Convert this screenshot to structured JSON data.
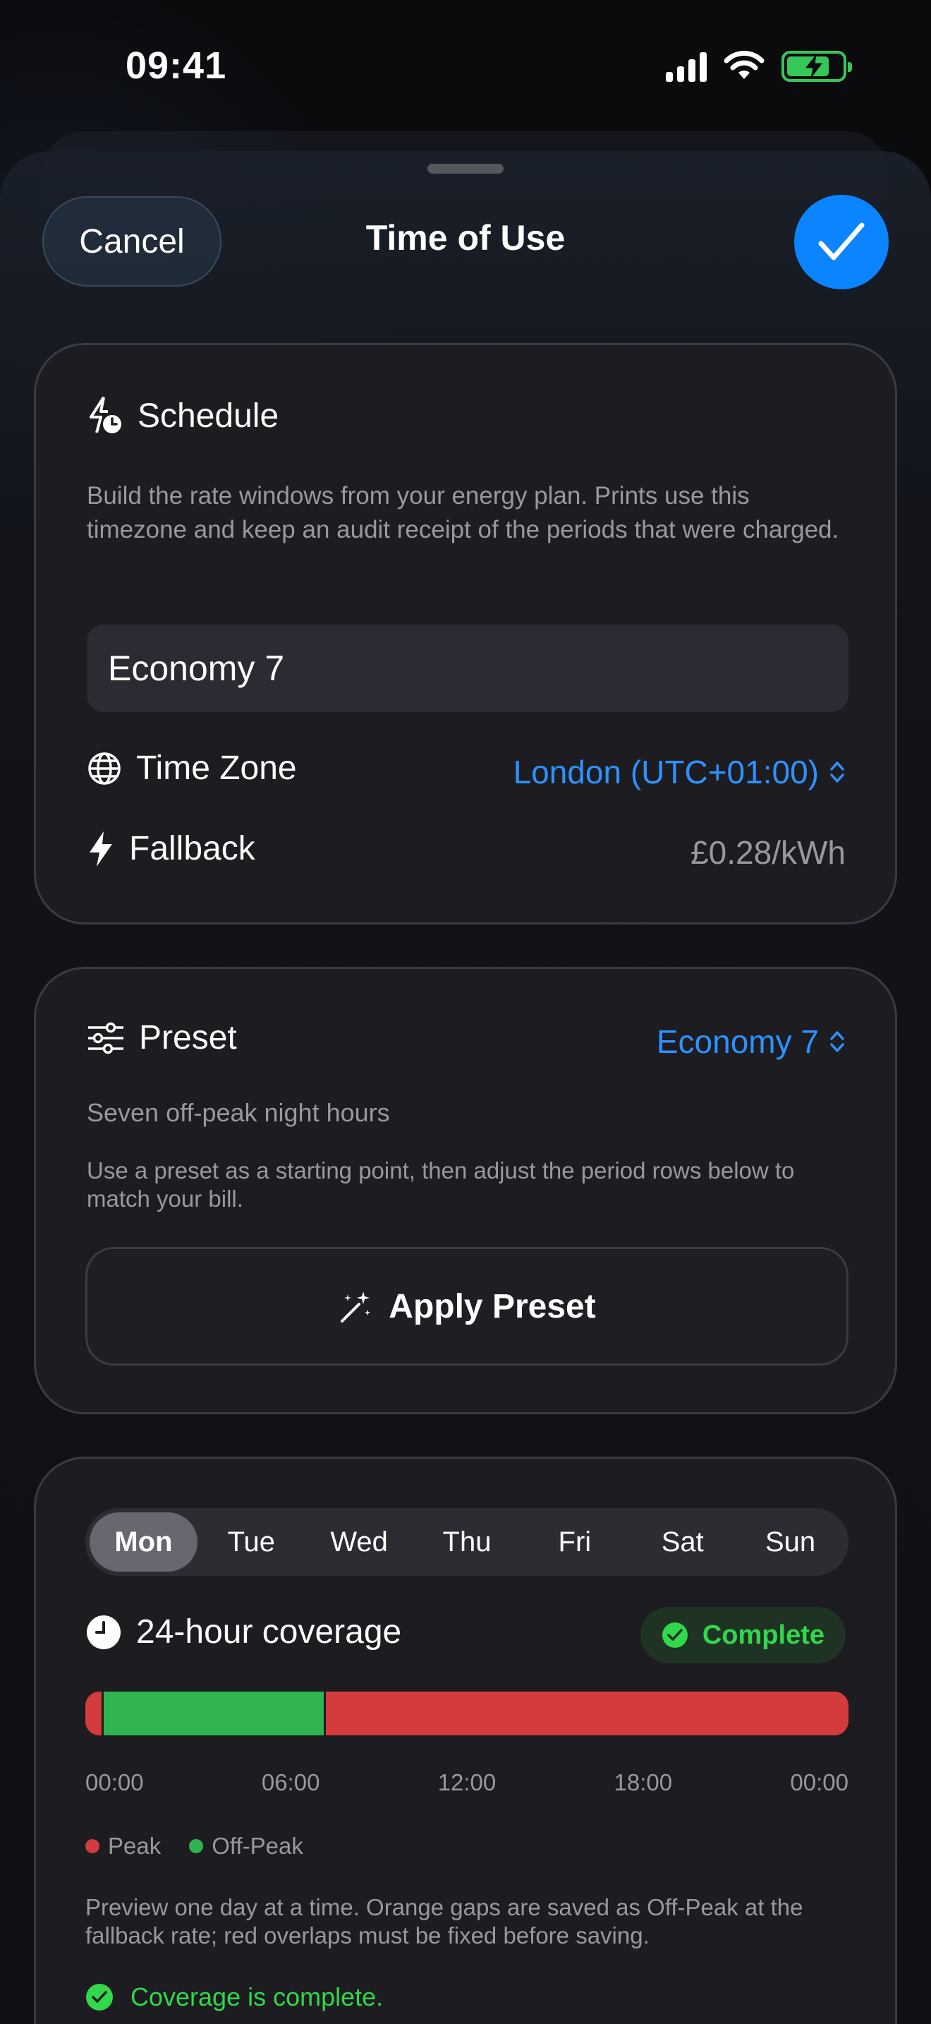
{
  "status_bar": {
    "time": "09:41"
  },
  "nav": {
    "cancel": "Cancel",
    "title": "Time of Use"
  },
  "schedule": {
    "heading": "Schedule",
    "description": "Build the rate windows from your energy plan. Prints use this timezone and keep an audit receipt of the periods that were charged.",
    "name_value": "Economy 7",
    "time_zone_label": "Time Zone",
    "time_zone_value": "London (UTC+01:00)",
    "fallback_label": "Fallback",
    "fallback_value": "£0.28/kWh"
  },
  "preset": {
    "label": "Preset",
    "value": "Economy 7",
    "subtitle": "Seven off-peak night hours",
    "hint": "Use a preset as a starting point, then adjust the period rows below to match your bill.",
    "apply": "Apply Preset"
  },
  "coverage": {
    "days": [
      "Mon",
      "Tue",
      "Wed",
      "Thu",
      "Fri",
      "Sat",
      "Sun"
    ],
    "selected_day": "Mon",
    "heading": "24-hour coverage",
    "badge": "Complete",
    "ticks": [
      "00:00",
      "06:00",
      "12:00",
      "18:00",
      "00:00"
    ],
    "legend": {
      "peak": "Peak",
      "offpeak": "Off-Peak"
    },
    "note": "Preview one day at a time. Orange gaps are saved as Off-Peak at the fallback rate; red overlaps must be fixed before saving.",
    "status": "Coverage is complete."
  },
  "colors": {
    "peak": "#d33b3d",
    "offpeak": "#2fb44f",
    "accent": "#0a84ff",
    "success": "#32d74b"
  },
  "timeline_hours": [
    {
      "type": "peak",
      "start": 0,
      "end": 0.5
    },
    {
      "type": "offpeak",
      "start": 0.5,
      "end": 7.5
    },
    {
      "type": "peak",
      "start": 7.5,
      "end": 24
    }
  ]
}
